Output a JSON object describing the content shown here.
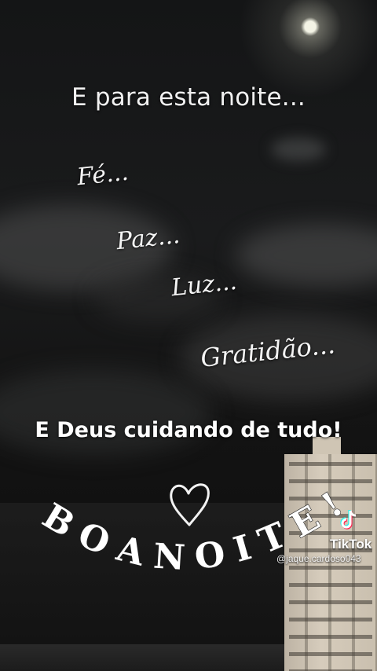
{
  "overlay": {
    "title": "E para esta noite...",
    "words": [
      "Fé...",
      "Paz...",
      "Luz...",
      "Gratidão..."
    ],
    "subtitle": "E Deus cuidando de tudo!",
    "greeting": "BOA NOITE!"
  },
  "watermark": {
    "brand": "TikTok",
    "handle": "@jaque.cardoso043",
    "icon": "tiktok-logo-icon"
  },
  "decor": {
    "heart_icon": "heart-outline-icon",
    "scene": "night-sky-moon-clouds-building"
  }
}
